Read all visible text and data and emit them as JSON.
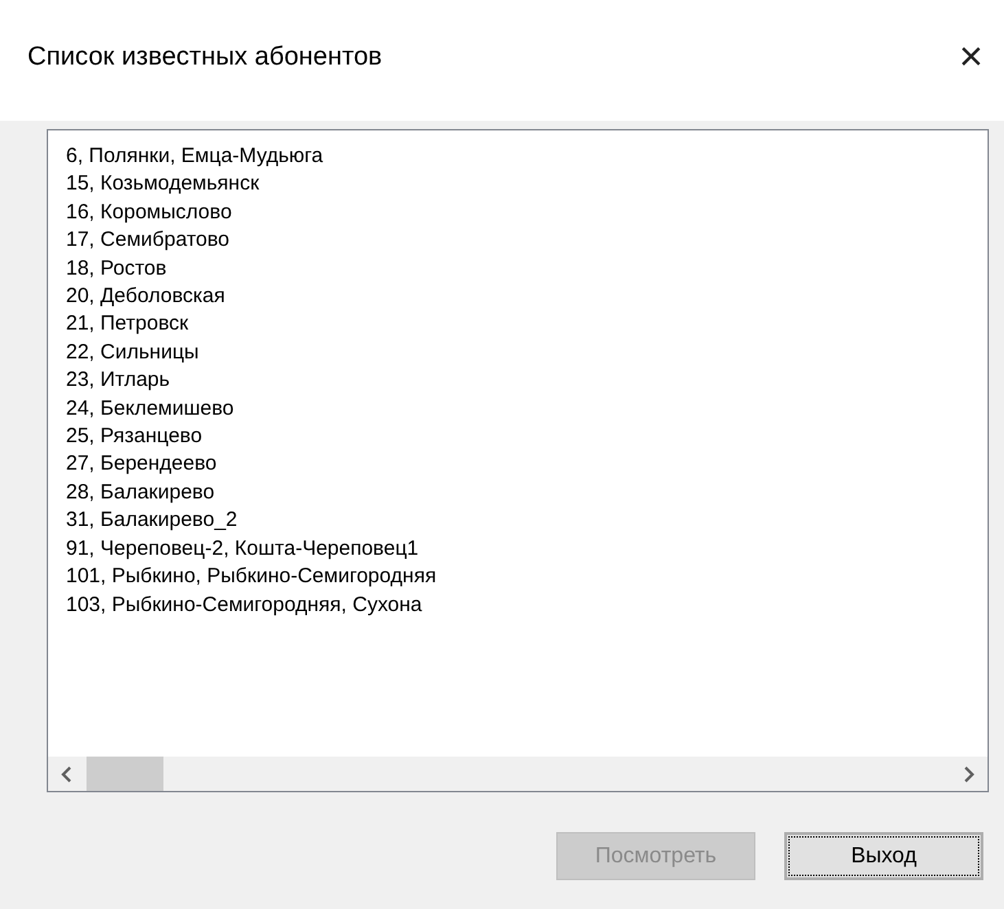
{
  "window": {
    "title": "Список известных абонентов",
    "close": "×"
  },
  "list": {
    "items": [
      "6, Полянки, Емца-Мудьюга",
      "15, Козьмодемьянск",
      "16, Коромыслово",
      "17, Семибратово",
      "18, Ростов",
      "20, Деболовская",
      "21, Петровск",
      "22, Сильницы",
      "23, Итларь",
      "24, Беклемишево",
      "25, Рязанцево",
      "27, Берендеево",
      "28, Балакирево",
      "31, Балакирево_2",
      "91, Череповец-2, Кошта-Череповец1",
      "101, Рыбкино, Рыбкино-Семигородняя",
      "103, Рыбкино-Семигородняя, Сухона"
    ]
  },
  "buttons": [
    {
      "label": "Посмотреть",
      "disabled": true,
      "focused": false
    },
    {
      "label": "Выход",
      "disabled": false,
      "focused": true
    }
  ]
}
